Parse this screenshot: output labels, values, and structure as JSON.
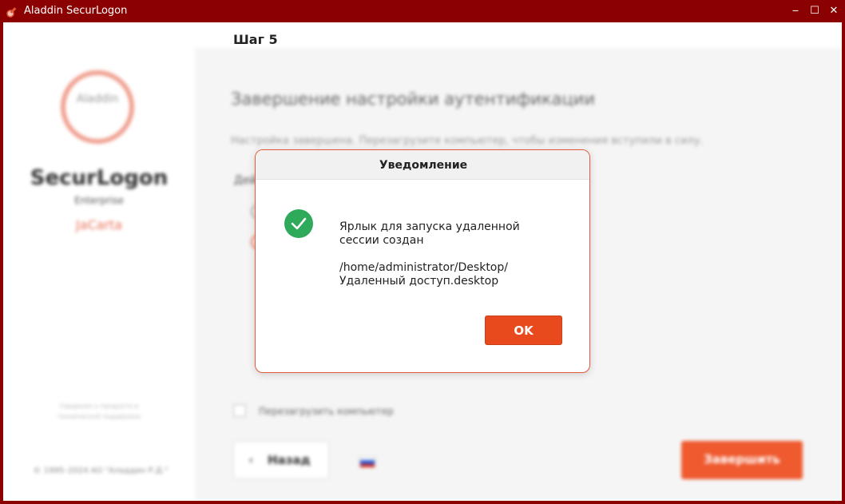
{
  "window": {
    "title": "Aladdin SecurLogon",
    "minimize_glyph": "‒",
    "maximize_glyph": "☐",
    "close_glyph": "✕"
  },
  "sidebar": {
    "logo_text": "Aladdin",
    "product_name": "SecurLogon",
    "product_edition": "Enterprise",
    "device_name": "JaCarta",
    "note": "Сведения о продукте и технической поддержке",
    "copyright": "© 1995–2024 АО \"Аладдин Р.Д.\""
  },
  "main": {
    "step_label": "Шаг 5",
    "title": "Завершение настройки аутентификации",
    "description": "Настройка завершена. Перезагрузите компьютер, чтобы изменения вступили в силу.",
    "action_label": "Действия",
    "reboot_label": "Перезагрузить компьютер",
    "back_chevron": "‹",
    "back_label": "Назад",
    "finish_label": "Завершить"
  },
  "dialog": {
    "title": "Уведомление",
    "message_line1": "Ярлык для запуска удаленной",
    "message_line2": "сессии создан",
    "path_line1": "/home/administrator/Desktop/",
    "path_line2": "Удаленный доступ.desktop",
    "ok_label": "OK"
  },
  "colors": {
    "frame": "#8b0000",
    "accent": "#e84a1e",
    "success": "#2fa95a"
  }
}
